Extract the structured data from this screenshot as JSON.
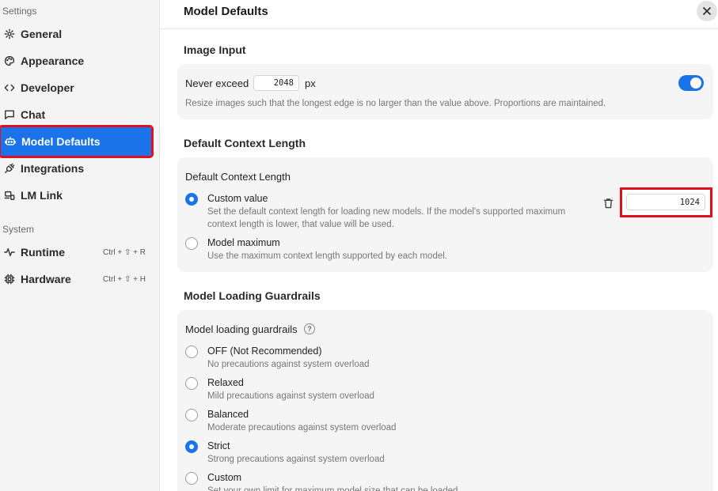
{
  "sidebar": {
    "settings_heading": "Settings",
    "system_heading": "System",
    "items": [
      {
        "label": "General",
        "icon": "gear-icon"
      },
      {
        "label": "Appearance",
        "icon": "palette-icon"
      },
      {
        "label": "Developer",
        "icon": "code-icon"
      },
      {
        "label": "Chat",
        "icon": "chat-bubble-icon"
      },
      {
        "label": "Model Defaults",
        "icon": "robot-icon",
        "active": true
      },
      {
        "label": "Integrations",
        "icon": "plug-icon"
      },
      {
        "label": "LM Link",
        "icon": "link-device-icon"
      }
    ],
    "system_items": [
      {
        "label": "Runtime",
        "icon": "pulse-icon",
        "shortcut": "Ctrl + ⇧ + R"
      },
      {
        "label": "Hardware",
        "icon": "chip-icon",
        "shortcut": "Ctrl + ⇧ + H"
      }
    ]
  },
  "header": {
    "title": "Model Defaults"
  },
  "image_input": {
    "section_title": "Image Input",
    "label": "Never exceed",
    "value": "2048",
    "unit": "px",
    "toggle_on": true,
    "description": "Resize images such that the longest edge is no larger than the value above. Proportions are maintained."
  },
  "context_length": {
    "section_title": "Default Context Length",
    "card_title": "Default Context Length",
    "options": [
      {
        "label": "Custom value",
        "description_line1": "Set the default context length for loading new models. If the model's supported maximum",
        "description_line2": "context length is lower, that value will be used.",
        "checked": true
      },
      {
        "label": "Model maximum",
        "description": "Use the maximum context length supported by each model.",
        "checked": false
      }
    ],
    "value": "1024"
  },
  "guardrails": {
    "section_title": "Model Loading Guardrails",
    "card_title": "Model loading guardrails",
    "help_glyph": "?",
    "options": [
      {
        "label": "OFF (Not Recommended)",
        "description": "No precautions against system overload",
        "checked": false
      },
      {
        "label": "Relaxed",
        "description": "Mild precautions against system overload",
        "checked": false
      },
      {
        "label": "Balanced",
        "description": "Moderate precautions against system overload",
        "checked": false
      },
      {
        "label": "Strict",
        "description": "Strong precautions against system overload",
        "checked": true
      },
      {
        "label": "Custom",
        "description": "Set your own limit for maximum model size that can be loaded",
        "checked": false
      }
    ]
  },
  "colors": {
    "accent": "#1a73e8",
    "highlight": "#e0101c"
  }
}
